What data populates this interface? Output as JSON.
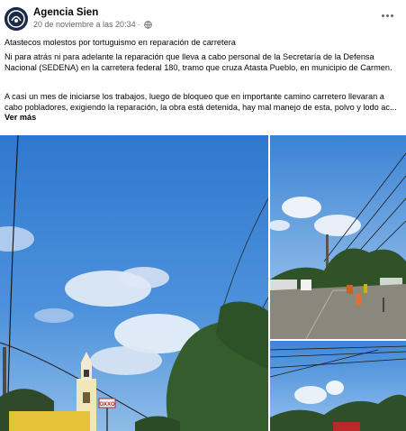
{
  "post": {
    "author": "Agencia Sien",
    "timestamp": "20 de noviembre a las 20:34",
    "separator": "·",
    "audience_icon": "globe-icon",
    "more_icon": "more-horizontal-icon",
    "title": "Atastecos molestos por tortuguismo en reparación de carretera",
    "paragraph1": "Ni para atrás ni para adelante la reparación que lleva a cabo personal de la Secretaría de la Defensa Nacional (SEDENA)  en la carretera federal 180, tramo que cruza Atasta Pueblo, en municipio de Carmen.",
    "paragraph2": "A casi un mes de iniciarse los trabajos, luego de bloqueo que en importante camino carretero llevaran a cabo pobladores, exigiendo la reparación,  la obra está detenida,  hay mal manejo de esta,  polvo y lodo ac...",
    "see_more": "Ver más"
  },
  "photos": {
    "main_sign": "OXXO",
    "colors": {
      "sky": "#3f86d6",
      "sky_light": "#8dbbe9",
      "cloud": "#e9f0f8",
      "tree": "#3a5a2a",
      "road": "#8f8a80"
    }
  }
}
